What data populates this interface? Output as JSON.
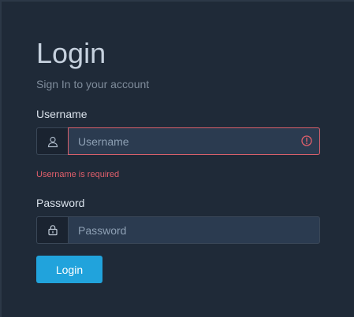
{
  "login": {
    "title": "Login",
    "subtitle": "Sign In to your account",
    "username": {
      "label": "Username",
      "placeholder": "Username",
      "value": "",
      "icon": "user-icon",
      "error": "Username is required",
      "status_icon": "error-circle-icon"
    },
    "password": {
      "label": "Password",
      "placeholder": "Password",
      "value": "",
      "icon": "lock-icon"
    },
    "submit_label": "Login"
  },
  "colors": {
    "background": "#1f2a38",
    "accent": "#21a3dc",
    "error": "#e15f6b",
    "input_fill": "#2b3b50"
  }
}
